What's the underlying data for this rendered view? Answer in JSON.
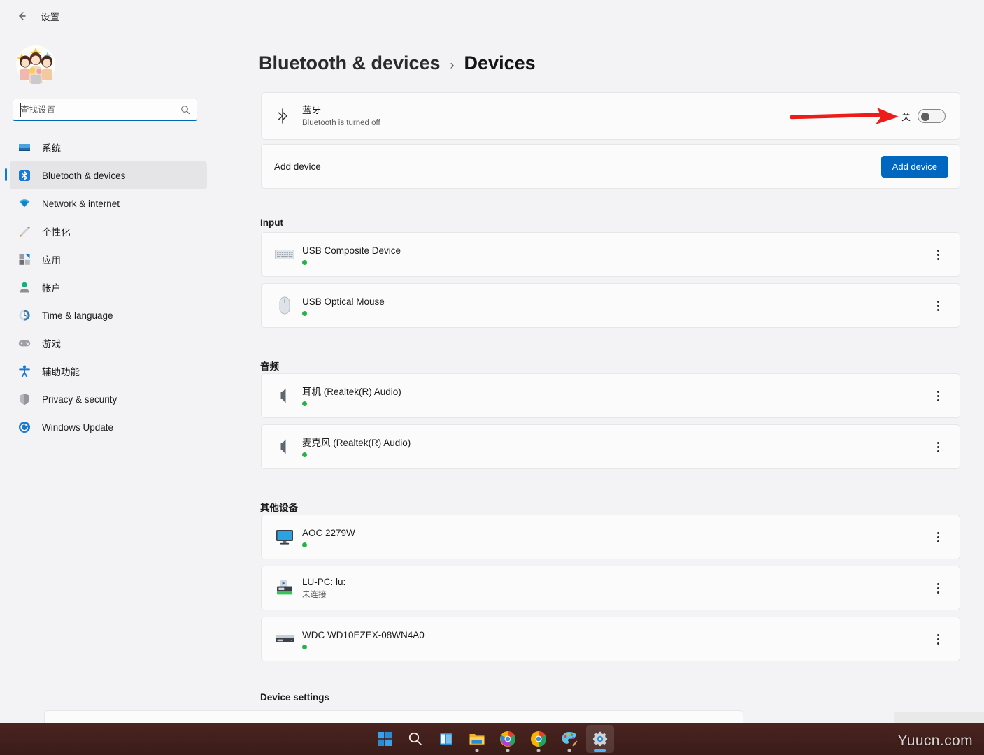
{
  "window": {
    "back_icon": "back-arrow-icon",
    "title": "设置"
  },
  "sidebar": {
    "avatar_alt": "user-avatar",
    "search": {
      "placeholder": "查找设置",
      "value": "",
      "icon": "search-icon"
    },
    "items": [
      {
        "label": "系统",
        "icon": "system-icon",
        "selected": false
      },
      {
        "label": "Bluetooth & devices",
        "icon": "bluetooth-icon",
        "selected": true
      },
      {
        "label": "Network & internet",
        "icon": "wifi-icon",
        "selected": false
      },
      {
        "label": "个性化",
        "icon": "personalization-icon",
        "selected": false
      },
      {
        "label": "应用",
        "icon": "apps-icon",
        "selected": false
      },
      {
        "label": "帐户",
        "icon": "accounts-icon",
        "selected": false
      },
      {
        "label": "Time & language",
        "icon": "clock-icon",
        "selected": false
      },
      {
        "label": "游戏",
        "icon": "gaming-icon",
        "selected": false
      },
      {
        "label": "辅助功能",
        "icon": "accessibility-icon",
        "selected": false
      },
      {
        "label": "Privacy & security",
        "icon": "shield-icon",
        "selected": false
      },
      {
        "label": "Windows Update",
        "icon": "update-icon",
        "selected": false
      }
    ]
  },
  "main": {
    "breadcrumb": {
      "parent": "Bluetooth & devices",
      "separator": "›",
      "current": "Devices"
    },
    "bluetooth": {
      "icon": "bluetooth-icon",
      "title": "蓝牙",
      "subtitle": "Bluetooth is turned off",
      "state_label": "关",
      "toggle_on": false
    },
    "add_device": {
      "label": "Add device",
      "button_label": "Add device",
      "button_color": "#0067c0"
    },
    "sections": [
      {
        "title": "Input",
        "devices": [
          {
            "name": "USB Composite Device",
            "icon": "keyboard-icon",
            "connected": true,
            "status": ""
          },
          {
            "name": "USB Optical Mouse",
            "icon": "mouse-icon",
            "connected": true,
            "status": ""
          }
        ]
      },
      {
        "title": "音频",
        "devices": [
          {
            "name": "耳机 (Realtek(R) Audio)",
            "icon": "speaker-icon",
            "connected": true,
            "status": ""
          },
          {
            "name": "麦克风 (Realtek(R) Audio)",
            "icon": "speaker-icon",
            "connected": true,
            "status": ""
          }
        ]
      },
      {
        "title": "其他设备",
        "devices": [
          {
            "name": "AOC 2279W",
            "icon": "monitor-icon",
            "connected": true,
            "status": ""
          },
          {
            "name": "LU-PC: lu:",
            "icon": "media-device-icon",
            "connected": false,
            "status": "未连接"
          },
          {
            "name": "WDC WD10EZEX-08WN4A0",
            "icon": "disk-drive-icon",
            "connected": true,
            "status": ""
          }
        ]
      }
    ],
    "device_settings_title": "Device settings",
    "kebab_icon": "more-options-icon",
    "annotation": {
      "type": "red-arrow",
      "color": "#ee1c18"
    }
  },
  "taskbar": {
    "items": [
      {
        "icon": "windows-start-icon",
        "active": false,
        "running": false
      },
      {
        "icon": "search-icon",
        "active": false,
        "running": false
      },
      {
        "icon": "task-view-icon",
        "active": false,
        "running": false
      },
      {
        "icon": "file-explorer-icon",
        "active": false,
        "running": true
      },
      {
        "icon": "chrome-canary-icon",
        "active": false,
        "running": true
      },
      {
        "icon": "chrome-icon",
        "active": false,
        "running": true
      },
      {
        "icon": "paint-icon",
        "active": false,
        "running": true
      },
      {
        "icon": "settings-gear-icon",
        "active": true,
        "running": true
      }
    ],
    "watermark": "Yuucn.com"
  },
  "colors": {
    "accent": "#0067c0",
    "selected_nav": "#0b7ad1",
    "status_connected": "#2ab04a",
    "annotation_red": "#ee1c18",
    "page_bg": "#f3f3f5",
    "card_bg": "#fbfbfb"
  }
}
